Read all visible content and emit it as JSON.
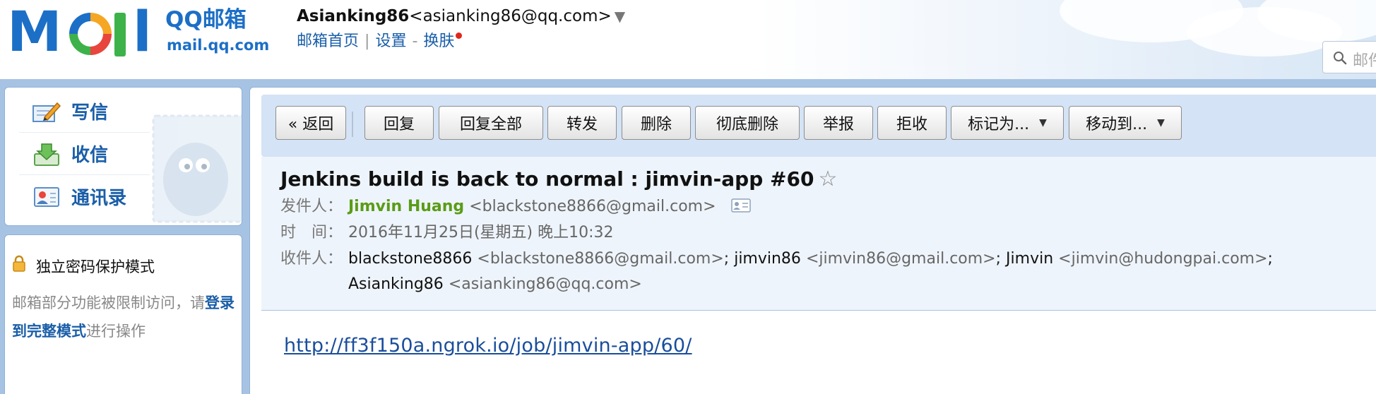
{
  "header": {
    "logo_text": "MOil",
    "brand_cn": "QQ邮箱",
    "brand_url": "mail.qq.com",
    "user_name": "Asianking86",
    "user_email": "<asianking86@qq.com>",
    "user_caret": "▼",
    "links": {
      "home": "邮箱首页",
      "divider": "|",
      "settings": "设置",
      "dash": "-",
      "skin": "换肤"
    },
    "search_placeholder": "邮件"
  },
  "sidebar": {
    "nav": [
      {
        "label": "写信",
        "icon": "compose-icon"
      },
      {
        "label": "收信",
        "icon": "inbox-icon"
      },
      {
        "label": "通讯录",
        "icon": "contacts-icon"
      }
    ],
    "secure": {
      "title": "独立密码保护模式",
      "body_prefix": "邮箱部分功能被限制访问，请",
      "link": "登录到完整模式",
      "body_suffix": "进行操作"
    }
  },
  "toolbar": {
    "back": "« 返回",
    "reply": "回复",
    "reply_all": "回复全部",
    "forward": "转发",
    "delete": "删除",
    "delete_perm": "彻底删除",
    "report": "举报",
    "reject": "拒收",
    "mark_as": "标记为...",
    "move_to": "移动到..."
  },
  "email": {
    "subject": "Jenkins build is back to normal : jimvin-app #60",
    "star": "☆",
    "from_label": "发件人：",
    "from_name": "Jimvin Huang",
    "from_addr": "<blackstone8866@gmail.com>",
    "time_label": "时　间：",
    "time_value": "2016年11月25日(星期五) 晚上10:32",
    "to_label": "收件人：",
    "recipients": [
      {
        "name": "blackstone8866",
        "addr": "<blackstone8866@gmail.com>",
        "sep": ";"
      },
      {
        "name": "jimvin86",
        "addr": "<jimvin86@gmail.com>",
        "sep": ";"
      },
      {
        "name": "Jimvin",
        "addr": "<jimvin@hudongpai.com>",
        "sep": ";"
      },
      {
        "name": "Asianking86",
        "addr": "<asianking86@qq.com>",
        "sep": ""
      }
    ],
    "body_link": "http://ff3f150a.ngrok.io/job/jimvin-app/60/"
  },
  "colors": {
    "brand_blue": "#1c6fc6",
    "link_blue": "#1a5ea8",
    "sender_green": "#5a9c16",
    "toolbar_bg": "#d4e3f5",
    "frame_blue": "#a7c3e3"
  }
}
